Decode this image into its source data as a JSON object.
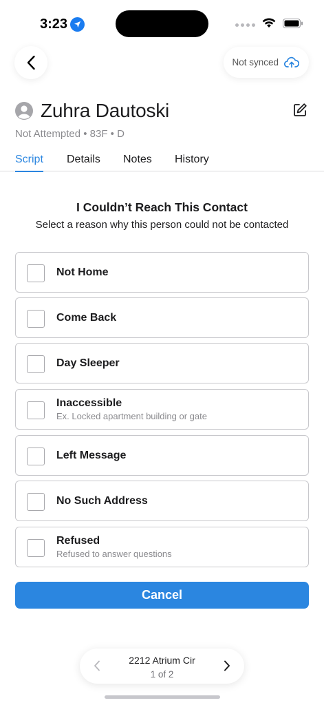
{
  "status_bar": {
    "time": "3:23",
    "icons": [
      "location-arrow-icon",
      "signal-dots-icon",
      "wifi-icon",
      "battery-icon"
    ]
  },
  "nav": {
    "back_icon": "chevron-left-icon",
    "sync_label": "Not synced",
    "sync_icon": "cloud-upload-icon"
  },
  "contact": {
    "name": "Zuhra Dautoski",
    "subtitle": "Not Attempted • 83F • D",
    "avatar_icon": "person-circle-icon",
    "edit_icon": "edit-icon"
  },
  "tabs": [
    {
      "label": "Script",
      "active": true
    },
    {
      "label": "Details",
      "active": false
    },
    {
      "label": "Notes",
      "active": false
    },
    {
      "label": "History",
      "active": false
    }
  ],
  "section": {
    "title": "I Couldn’t Reach This Contact",
    "subtitle": "Select a reason why this person could not be contacted"
  },
  "options": [
    {
      "label": "Not Home",
      "hint": "",
      "checked": false
    },
    {
      "label": "Come Back",
      "hint": "",
      "checked": false
    },
    {
      "label": "Day Sleeper",
      "hint": "",
      "checked": false
    },
    {
      "label": "Inaccessible",
      "hint": "Ex. Locked apartment building or gate",
      "checked": false
    },
    {
      "label": "Left Message",
      "hint": "",
      "checked": false
    },
    {
      "label": "No Such Address",
      "hint": "",
      "checked": false
    },
    {
      "label": "Refused",
      "hint": "Refused to answer questions",
      "checked": false
    }
  ],
  "cancel_label": "Cancel",
  "pager": {
    "address": "2212 Atrium Cir",
    "count": "1 of 2"
  },
  "colors": {
    "accent": "#2b86e0",
    "text": "#1c1c1e",
    "muted": "#8a8a8e",
    "border": "#c8c8cc"
  }
}
